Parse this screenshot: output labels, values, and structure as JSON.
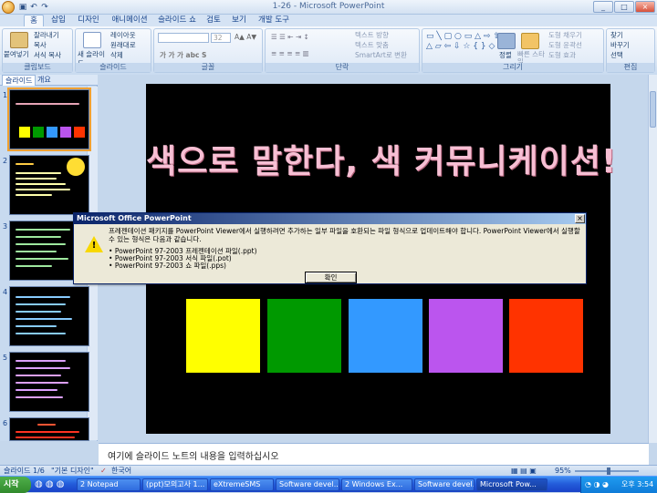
{
  "window": {
    "title": "1-26 - Microsoft PowerPoint"
  },
  "ribbon_tabs": [
    "홈",
    "삽입",
    "디자인",
    "애니메이션",
    "슬라이드 쇼",
    "검토",
    "보기",
    "개발 도구"
  ],
  "ribbon": {
    "clipboard": {
      "title": "클립보드",
      "paste": "붙여넣기",
      "cut": "잘라내기",
      "copy": "복사",
      "format_painter": "서식 복사"
    },
    "slides": {
      "title": "슬라이드",
      "new_slide": "새 슬라이드",
      "layout": "레이아웃",
      "reset": "원래대로",
      "delete": "삭제"
    },
    "font": {
      "title": "글꼴",
      "size": "32"
    },
    "paragraph": {
      "title": "단락",
      "text_direction": "텍스트 방향",
      "align_text": "텍스트 맞춤",
      "smartart": "SmartArt로 변환"
    },
    "drawing": {
      "title": "그리기",
      "arrange": "정렬",
      "quick_styles": "빠른 스타일",
      "shape_fill": "도형 채우기",
      "shape_outline": "도형 윤곽선",
      "shape_effects": "도형 효과"
    },
    "editing": {
      "title": "편집",
      "find": "찾기",
      "replace": "바꾸기",
      "select": "선택"
    }
  },
  "panel_tabs": [
    "슬라이드",
    "개요"
  ],
  "slide_numbers": [
    "1",
    "2",
    "3",
    "4",
    "5",
    "6"
  ],
  "slide": {
    "title": "색으로 말한다, 색 커뮤니케이션!",
    "swatches": [
      "#ffff00",
      "#009900",
      "#3399ff",
      "#bb55ee",
      "#ff3300"
    ]
  },
  "notes_placeholder": "여기에 슬라이드 노트의 내용을 입력하십시오",
  "status": {
    "slide": "슬라이드 1/6",
    "theme": "\"기본 디자인\"",
    "language": "한국어",
    "zoom": "95%"
  },
  "dialog": {
    "title": "Microsoft Office PowerPoint",
    "message": "프레젠테이션 패키지를 PowerPoint Viewer에서 실행하려면 추가하는 일부 파일을 호환되는 파일 형식으로 업데이트해야 합니다. PowerPoint Viewer에서 실행할 수 있는 형식은 다음과 같습니다.",
    "formats": [
      "PowerPoint 97-2003 프레젠테이션 파일(.ppt)",
      "PowerPoint 97-2003 서식 파일(.pot)",
      "PowerPoint 97-2003 쇼 파일(.pps)"
    ],
    "ok": "확인"
  },
  "taskbar": {
    "start": "시작",
    "items": [
      "2 Notepad",
      "(ppt)모의고사 1...",
      "eXtremeSMS",
      "Software devel...",
      "2 Windows Ex...",
      "Software devel...",
      "Microsoft Pow..."
    ],
    "clock": "오후 3:54"
  }
}
